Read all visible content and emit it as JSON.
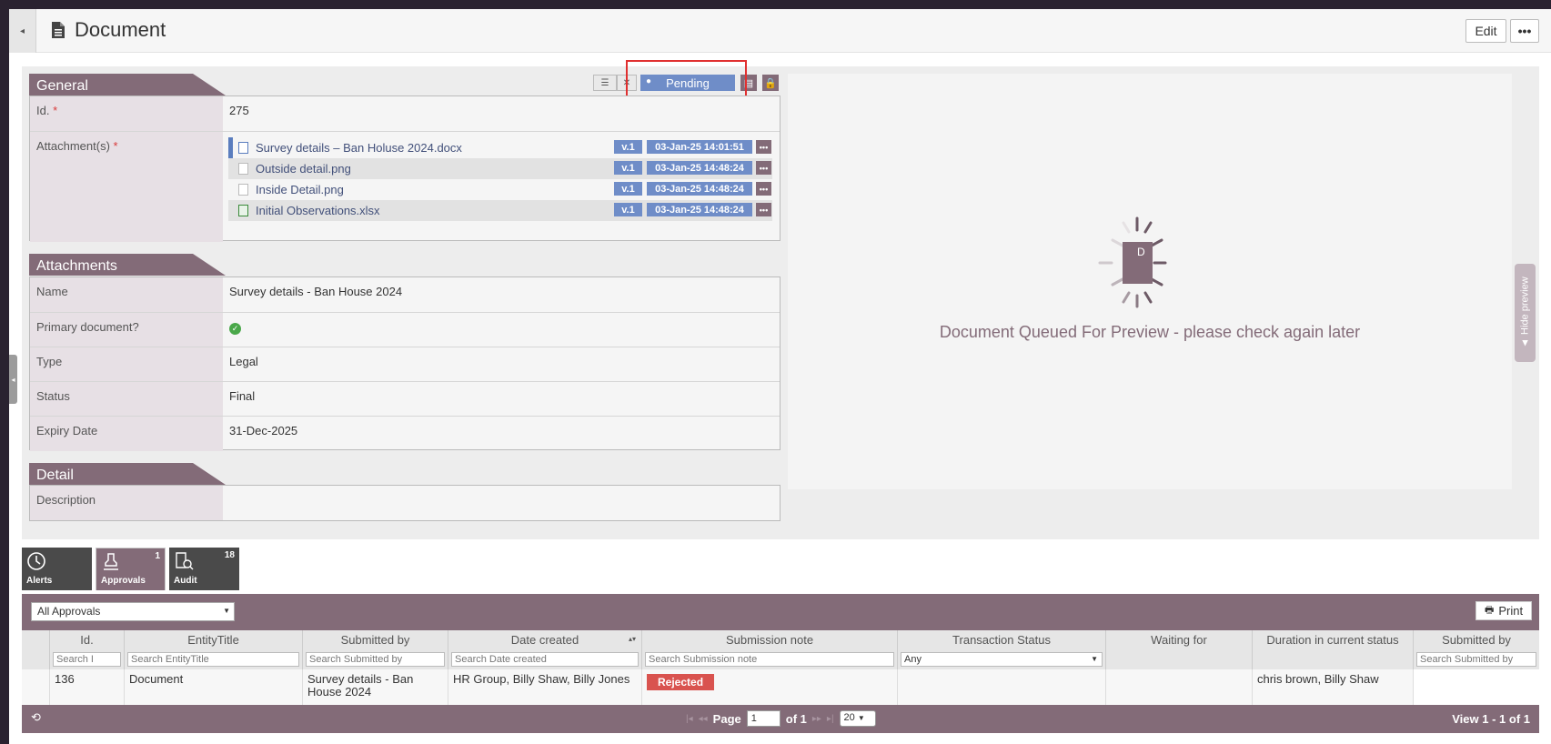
{
  "header": {
    "title": "Document",
    "edit_label": "Edit",
    "more_label": "•••"
  },
  "status": {
    "label": "Pending"
  },
  "general": {
    "title": "General",
    "id_label": "Id.",
    "id_value": "275",
    "attachments_label": "Attachment(s)",
    "required_mark": "*",
    "files": [
      {
        "name": "Survey details – Ban Holuse 2024.docx",
        "version": "v.1",
        "date": "03-Jan-25 14:01:51",
        "icon": "word-icon"
      },
      {
        "name": "Outside detail.png",
        "version": "v.1",
        "date": "03-Jan-25 14:48:24",
        "icon": "file-icon"
      },
      {
        "name": "Inside Detail.png",
        "version": "v.1",
        "date": "03-Jan-25 14:48:24",
        "icon": "file-icon"
      },
      {
        "name": "Initial Observations.xlsx",
        "version": "v.1",
        "date": "03-Jan-25 14:48:24",
        "icon": "excel-icon"
      }
    ]
  },
  "attachments": {
    "title": "Attachments",
    "name_label": "Name",
    "name_value": "Survey details - Ban House 2024",
    "primary_label": "Primary document?",
    "type_label": "Type",
    "type_value": "Legal",
    "status_label": "Status",
    "status_value": "Final",
    "expiry_label": "Expiry Date",
    "expiry_value": "31-Dec-2025"
  },
  "detail": {
    "title": "Detail",
    "description_label": "Description"
  },
  "preview": {
    "doc_letter": "D",
    "message": "Document Queued For Preview - please check again later",
    "hide_label": "▲ Hide preview"
  },
  "tabs": [
    {
      "label": "Alerts",
      "count": ""
    },
    {
      "label": "Approvals",
      "count": "1"
    },
    {
      "label": "Audit",
      "count": "18"
    }
  ],
  "grid": {
    "filter_value": "All Approvals",
    "print_label": "Print",
    "columns": [
      {
        "title": "Id.",
        "search": "Search I"
      },
      {
        "title": "EntityTitle",
        "search": "Search EntityTitle"
      },
      {
        "title": "Submitted by",
        "search": "Search Submitted by"
      },
      {
        "title": "Date created",
        "search": "Search Date created"
      },
      {
        "title": "Submission note",
        "search": "Search Submission note"
      },
      {
        "title": "Transaction Status",
        "search": "Any"
      },
      {
        "title": "Waiting for",
        "search": ""
      },
      {
        "title": "Duration in current status",
        "search": ""
      },
      {
        "title": "Submitted by",
        "search": "Search Submitted by"
      }
    ],
    "row": {
      "id": "136",
      "entity": "Document",
      "submitted_by": "Survey details - Ban House 2024",
      "date_created": "HR Group, Billy Shaw, Billy Jones",
      "submission_note": "Rejected",
      "transaction_status": "",
      "waiting_for": "",
      "duration": "chris brown, Billy Shaw",
      "submitted_by2": ""
    },
    "footer": {
      "page_label": "Page",
      "page_value": "1",
      "of_label": "of 1",
      "page_size": "20",
      "view_text": "View 1 - 1 of 1"
    }
  }
}
